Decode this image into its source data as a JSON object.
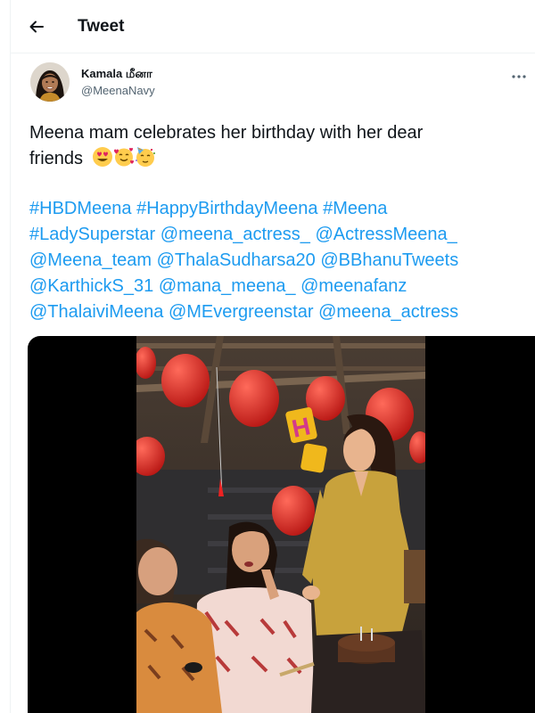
{
  "header": {
    "title": "Tweet",
    "back_icon": "arrow-left-icon"
  },
  "author": {
    "name": "Kamala மீனா",
    "handle": "@MeenaNavy",
    "more_icon": "more-horizontal-icon"
  },
  "tweet": {
    "text_line1": "Meena mam celebrates her birthday with her dear",
    "text_line2": "friends",
    "emojis": [
      "smiling-face-with-heart-eyes-icon",
      "smiling-face-with-hearts-icon",
      "partying-face-icon"
    ]
  },
  "hashtags": {
    "rows": [
      [
        "#HBDMeena",
        "#HappyBirthdayMeena",
        "#Meena"
      ],
      [
        "#LadySuperstar",
        "@meena_actress_",
        "@ActressMeena_"
      ],
      [
        "@Meena_team",
        "@ThalaSudharsa20",
        "@BBhanuTweets"
      ],
      [
        "@KarthickS_31",
        "@mana_meena_",
        "@meenafanz"
      ],
      [
        "@ThalaiviMeena",
        "@MEvergreenstar",
        "@meena_actress"
      ]
    ]
  },
  "colors": {
    "link": "#1d9bf0",
    "text": "#0f1419",
    "muted": "#536471",
    "media_background": "#000000"
  }
}
